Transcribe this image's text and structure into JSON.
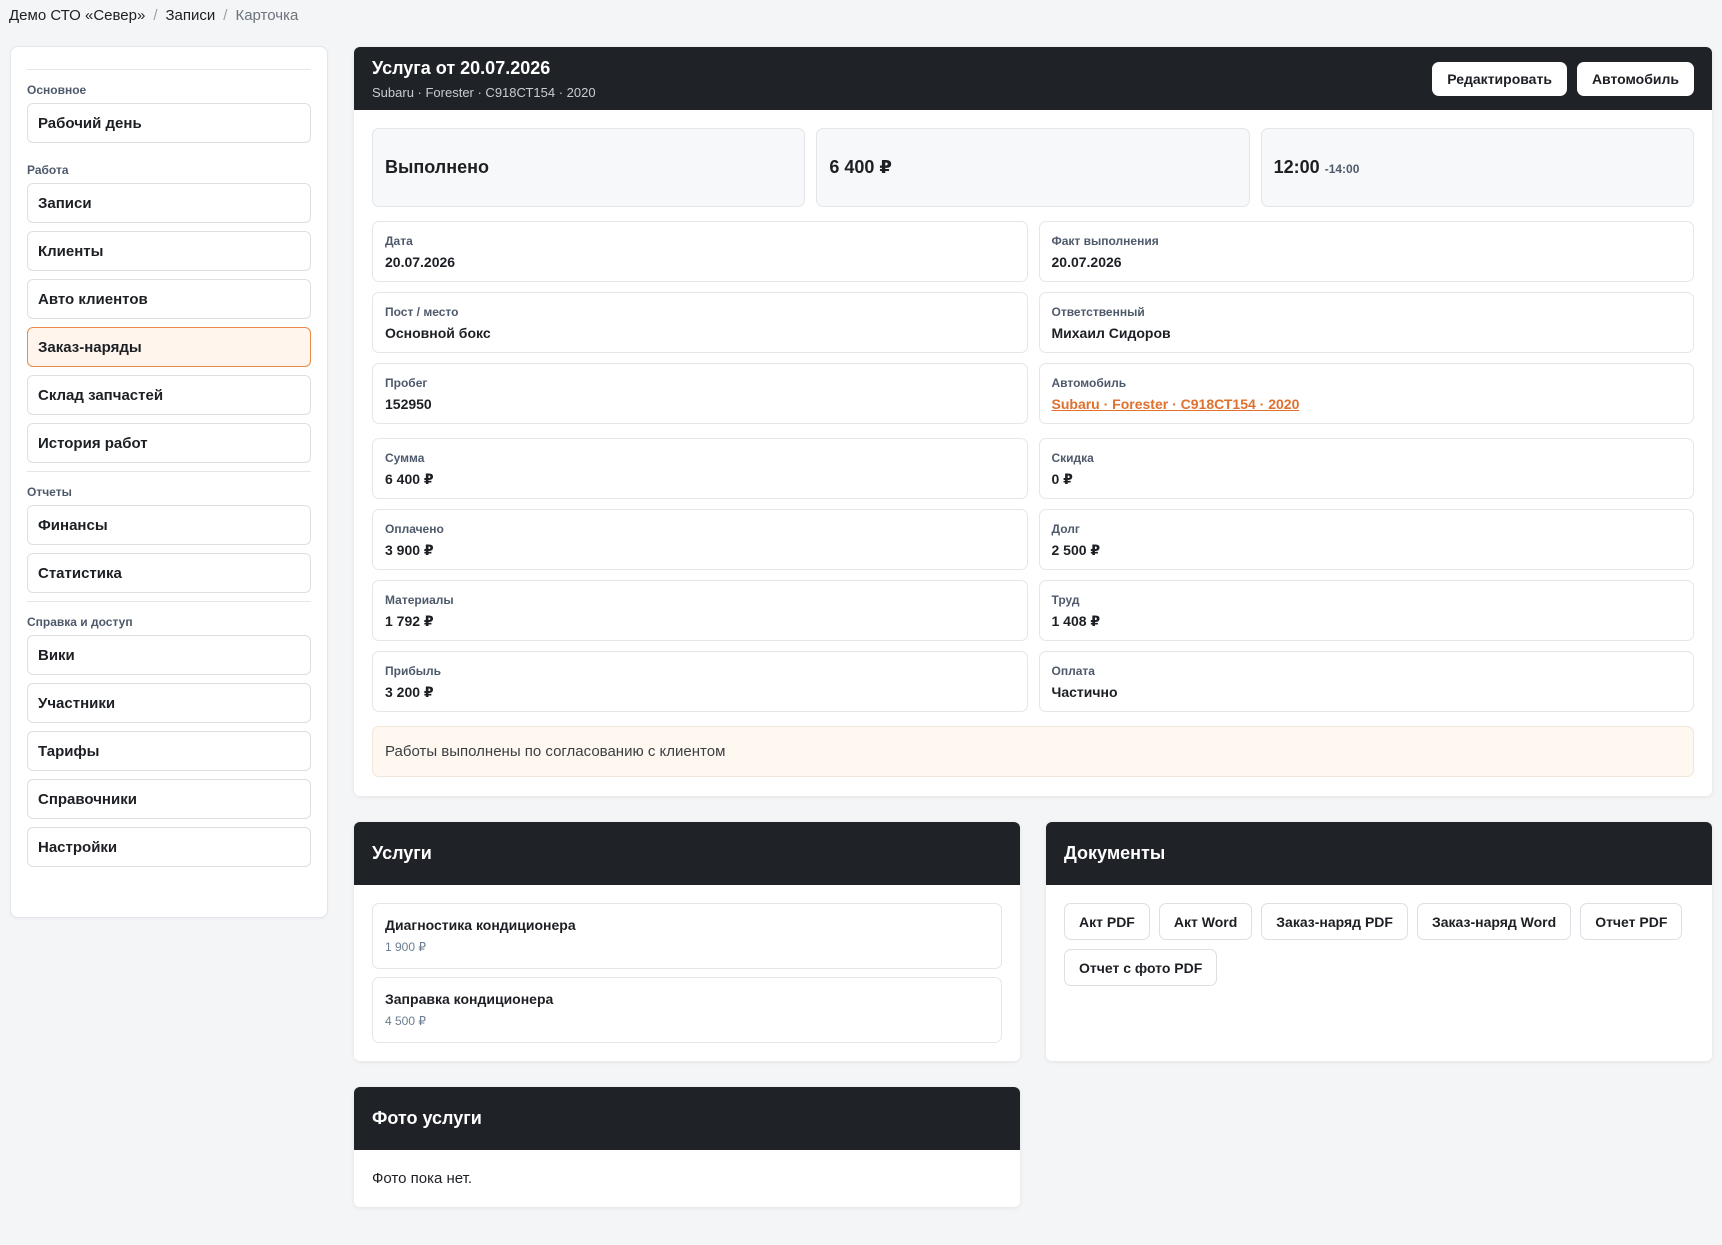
{
  "breadcrumb": {
    "items": [
      "Демо СТО «Север»",
      "Записи",
      "Карточка"
    ],
    "separator": "/"
  },
  "sidebar": {
    "groups": [
      {
        "label": "Основное",
        "items": [
          "Рабочий день"
        ]
      },
      {
        "label": "Работа",
        "items": [
          "Записи",
          "Клиенты",
          "Авто клиентов",
          "Заказ-наряды",
          "Склад запчастей",
          "История работ"
        ]
      },
      {
        "label": "Отчеты",
        "items": [
          "Финансы",
          "Статистика"
        ]
      },
      {
        "label": "Справка и доступ",
        "items": [
          "Вики",
          "Участники",
          "Тарифы",
          "Справочники",
          "Настройки"
        ]
      }
    ],
    "active_item": "Заказ-наряды"
  },
  "header": {
    "title": "Услуга от 20.07.2026",
    "subtitle": "Subaru · Forester · С918СТ154 · 2020",
    "edit_label": "Редактировать",
    "car_label": "Автомобиль"
  },
  "stats": {
    "status": "Выполнено",
    "amount": "6 400 ₽",
    "time_start": "12:00",
    "time_end": "-14:00"
  },
  "fields": {
    "date": {
      "label": "Дата",
      "value": "20.07.2026"
    },
    "done_fact": {
      "label": "Факт выполнения",
      "value": "20.07.2026"
    },
    "post": {
      "label": "Пост / место",
      "value": "Основной бокс"
    },
    "responsible": {
      "label": "Ответственный",
      "value": "Михаил Сидоров"
    },
    "mileage": {
      "label": "Пробег",
      "value": "152950"
    },
    "car": {
      "label": "Автомобиль",
      "value": "Subaru · Forester · С918СТ154 · 2020"
    },
    "sum": {
      "label": "Сумма",
      "value": "6 400 ₽"
    },
    "discount": {
      "label": "Скидка",
      "value": "0 ₽"
    },
    "paid": {
      "label": "Оплачено",
      "value": "3 900 ₽"
    },
    "debt": {
      "label": "Долг",
      "value": "2 500 ₽"
    },
    "materials": {
      "label": "Материалы",
      "value": "1 792 ₽"
    },
    "labor": {
      "label": "Труд",
      "value": "1 408 ₽"
    },
    "profit": {
      "label": "Прибыль",
      "value": "3 200 ₽"
    },
    "payment": {
      "label": "Оплата",
      "value": "Частично"
    }
  },
  "note": "Работы выполнены по согласованию с клиентом",
  "services": {
    "title": "Услуги",
    "items": [
      {
        "name": "Диагностика кондиционера",
        "price": "1 900 ₽"
      },
      {
        "name": "Заправка кондиционера",
        "price": "4 500 ₽"
      }
    ]
  },
  "documents": {
    "title": "Документы",
    "buttons": [
      "Акт PDF",
      "Акт Word",
      "Заказ-наряд PDF",
      "Заказ-наряд Word",
      "Отчет PDF",
      "Отчет с фото PDF"
    ]
  },
  "photos": {
    "title": "Фото услуги",
    "empty_text": "Фото пока нет."
  },
  "colors": {
    "header_bg": "#1f2227",
    "accent": "#e0702e",
    "active_bg": "#fff5ec",
    "note_bg": "#fff8f0"
  }
}
